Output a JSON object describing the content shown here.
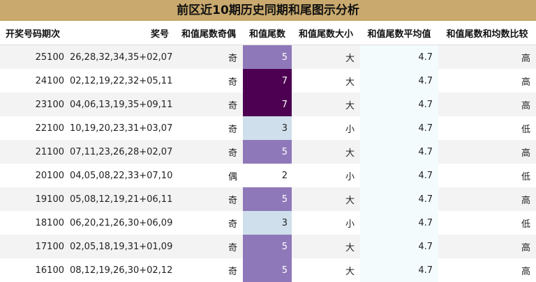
{
  "title": "前区近10期历史同期和尾图示分析",
  "headers": [
    "开奖号码期次",
    "奖号",
    "和值尾数奇偶",
    "和值尾数",
    "和值尾数大小",
    "和值尾数平均值",
    "和值尾数和均数比较"
  ],
  "rows": [
    {
      "period": "25100",
      "numbers": "26,28,32,34,35+02,07",
      "parity": "奇",
      "tail": 5,
      "size": "大",
      "avg": "4.7",
      "compare": "高"
    },
    {
      "period": "24100",
      "numbers": "02,12,19,22,32+05,11",
      "parity": "奇",
      "tail": 7,
      "size": "大",
      "avg": "4.7",
      "compare": "高"
    },
    {
      "period": "23100",
      "numbers": "04,06,13,19,35+09,11",
      "parity": "奇",
      "tail": 7,
      "size": "大",
      "avg": "4.7",
      "compare": "高"
    },
    {
      "period": "22100",
      "numbers": "10,19,20,23,31+03,07",
      "parity": "奇",
      "tail": 3,
      "size": "小",
      "avg": "4.7",
      "compare": "低"
    },
    {
      "period": "21100",
      "numbers": "07,11,23,26,28+02,07",
      "parity": "奇",
      "tail": 5,
      "size": "大",
      "avg": "4.7",
      "compare": "高"
    },
    {
      "period": "20100",
      "numbers": "04,05,08,22,33+07,10",
      "parity": "偶",
      "tail": 2,
      "size": "小",
      "avg": "4.7",
      "compare": "低"
    },
    {
      "period": "19100",
      "numbers": "05,08,12,19,21+06,11",
      "parity": "奇",
      "tail": 5,
      "size": "大",
      "avg": "4.7",
      "compare": "高"
    },
    {
      "period": "18100",
      "numbers": "06,20,21,26,30+06,09",
      "parity": "奇",
      "tail": 3,
      "size": "小",
      "avg": "4.7",
      "compare": "低"
    },
    {
      "period": "17100",
      "numbers": "02,05,18,19,31+01,09",
      "parity": "奇",
      "tail": 5,
      "size": "大",
      "avg": "4.7",
      "compare": "高"
    },
    {
      "period": "16100",
      "numbers": "08,12,19,26,30+02,12",
      "parity": "奇",
      "tail": 5,
      "size": "大",
      "avg": "4.7",
      "compare": "高"
    }
  ],
  "chart_data": {
    "type": "table",
    "title": "前区近10期历史同期和尾图示分析",
    "columns": [
      "开奖号码期次",
      "奖号",
      "和值尾数奇偶",
      "和值尾数",
      "和值尾数大小",
      "和值尾数平均值",
      "和值尾数和均数比较"
    ],
    "heat_column": "和值尾数",
    "heat_colors": {
      "2": "#ffffff",
      "3": "#cfdfec",
      "5": "#8f78b9",
      "7": "#4d0052"
    }
  }
}
